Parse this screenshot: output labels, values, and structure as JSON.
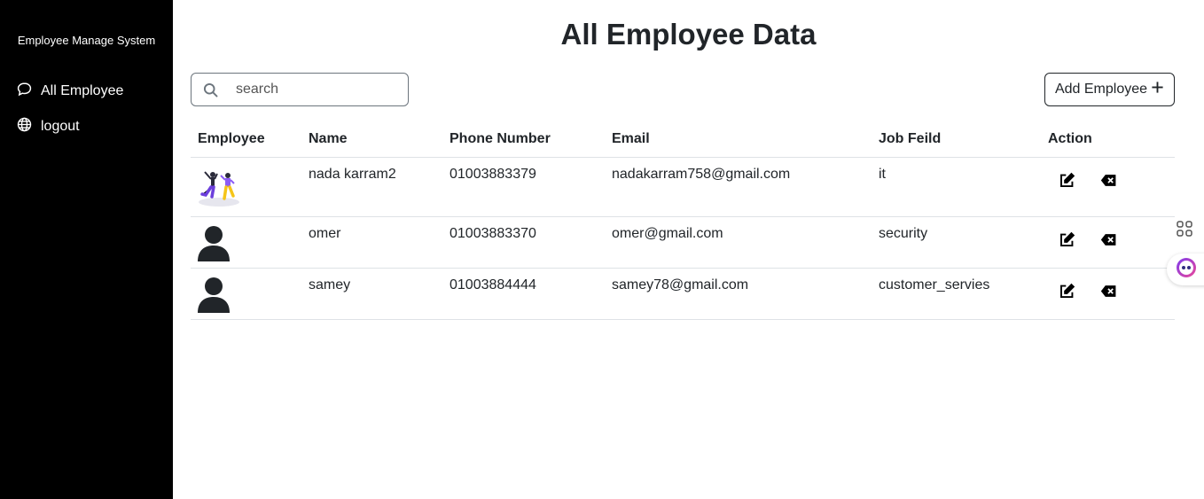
{
  "sidebar": {
    "brand": "Employee Manage System",
    "items": [
      {
        "label": "All Employee",
        "icon": "chat-bubble-icon"
      },
      {
        "label": "logout",
        "icon": "globe-icon"
      }
    ]
  },
  "header": {
    "title": "All Employee Data"
  },
  "search": {
    "placeholder": "search",
    "value": ""
  },
  "toolbar": {
    "add_label": "Add Employee"
  },
  "table": {
    "columns": [
      "Employee",
      "Name",
      "Phone Number",
      "Email",
      "Job Feild",
      "Action"
    ],
    "rows": [
      {
        "avatar": "illustration",
        "name": "nada karram2",
        "phone": "01003883379",
        "email": "nadakarram758@gmail.com",
        "job": "it"
      },
      {
        "avatar": "person-silhouette",
        "name": "omer",
        "phone": "01003883370",
        "email": "omer@gmail.com",
        "job": "security"
      },
      {
        "avatar": "person-silhouette",
        "name": "samey",
        "phone": "01003884444",
        "email": "samey78@gmail.com",
        "job": "customer_servies"
      }
    ]
  },
  "colors": {
    "sidebar_bg": "#000000",
    "text": "#212529",
    "border": "#dee2e6"
  }
}
